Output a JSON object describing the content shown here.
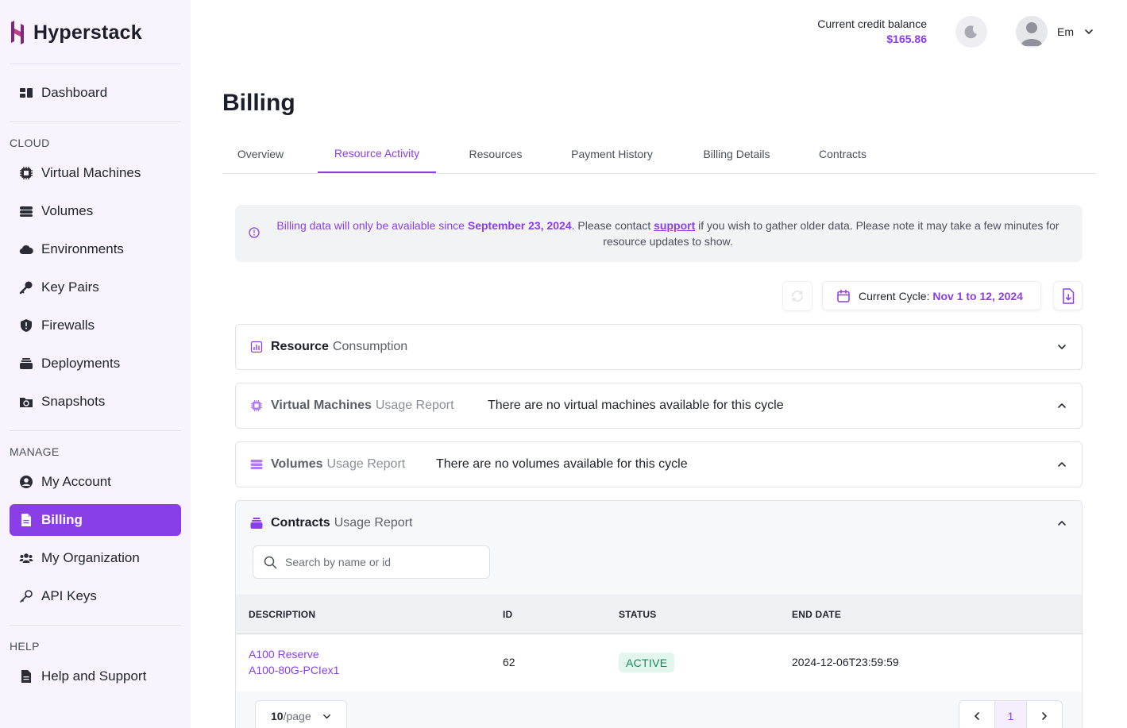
{
  "app": {
    "name": "Hyperstack"
  },
  "sidebar": {
    "top_items": [
      {
        "label": "Dashboard",
        "icon": "dashboard-icon"
      }
    ],
    "sections": {
      "cloud": "CLOUD",
      "manage": "MANAGE",
      "help": "HELP"
    },
    "cloud_items": [
      {
        "label": "Virtual Machines",
        "icon": "cpu-icon"
      },
      {
        "label": "Volumes",
        "icon": "database-icon"
      },
      {
        "label": "Environments",
        "icon": "cloud-icon"
      },
      {
        "label": "Key Pairs",
        "icon": "key-icon"
      },
      {
        "label": "Firewalls",
        "icon": "shield-icon"
      },
      {
        "label": "Deployments",
        "icon": "layers-icon"
      },
      {
        "label": "Snapshots",
        "icon": "snapshot-icon"
      }
    ],
    "manage_items": [
      {
        "label": "My Account",
        "icon": "user-circle-icon"
      },
      {
        "label": "Billing",
        "icon": "file-icon",
        "active": true
      },
      {
        "label": "My Organization",
        "icon": "users-icon"
      },
      {
        "label": "API Keys",
        "icon": "key-outline-icon"
      }
    ],
    "help_items": [
      {
        "label": "Help and Support",
        "icon": "document-icon"
      }
    ]
  },
  "header": {
    "credit_label": "Current credit balance",
    "credit_value": "$165.86",
    "user_name": "Em"
  },
  "page": {
    "title": "Billing"
  },
  "tabs": [
    {
      "label": "Overview"
    },
    {
      "label": "Resource Activity",
      "active": true
    },
    {
      "label": "Resources"
    },
    {
      "label": "Payment History"
    },
    {
      "label": "Billing Details"
    },
    {
      "label": "Contracts"
    }
  ],
  "notice": {
    "part1": "Billing data will only be available since ",
    "date": "September 23, 2024",
    "part2": ". Please contact ",
    "link": "support",
    "part3": " if you wish to gather older data. Please note it may take a few minutes for resource updates to show."
  },
  "toolbar": {
    "cycle_label": "Current Cycle: ",
    "cycle_value": "Nov 1 to 12, 2024"
  },
  "panels": {
    "consumption": {
      "title": "Resource",
      "subtitle": "Consumption"
    },
    "vms": {
      "title": "Virtual Machines",
      "subtitle": "Usage Report",
      "message": "There are no virtual machines available for this cycle"
    },
    "volumes": {
      "title": "Volumes",
      "subtitle": "Usage Report",
      "message": "There are no volumes available for this cycle"
    },
    "contracts": {
      "title": "Contracts",
      "subtitle": "Usage Report"
    }
  },
  "contracts_table": {
    "search_placeholder": "Search by name or id",
    "columns": [
      "DESCRIPTION",
      "ID",
      "STATUS",
      "END DATE"
    ],
    "rows": [
      {
        "name": "A100 Reserve",
        "detail": "A100-80G-PCIex1",
        "id": "62",
        "status": "ACTIVE",
        "end_date": "2024-12-06T23:59:59"
      }
    ],
    "page_size": "10",
    "page_size_unit": "/page",
    "current_page": "1"
  },
  "colors": {
    "accent": "#8a3fe6",
    "status_active_bg": "#e2f6ed",
    "status_active_text": "#14875a"
  }
}
